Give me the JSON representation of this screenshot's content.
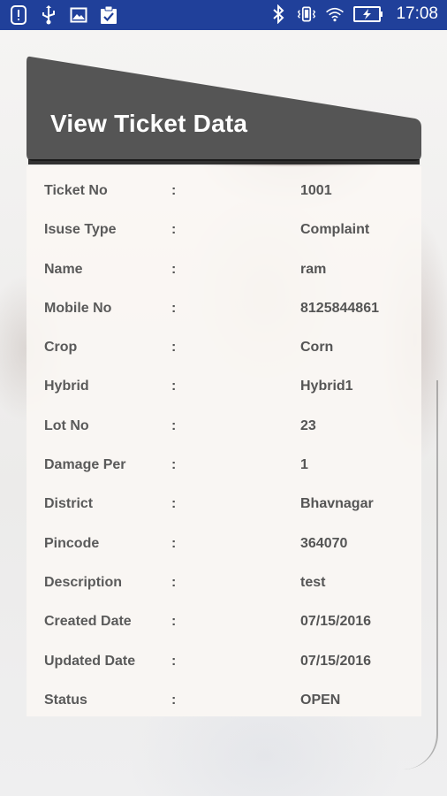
{
  "status_bar": {
    "left_icons": [
      "alert-icon",
      "usb-icon",
      "image-icon",
      "clipboard-icon"
    ],
    "right_icons": [
      "bluetooth-icon",
      "vibrate-icon",
      "wifi-icon",
      "battery-charging-icon"
    ],
    "time": "17:08",
    "bar_color": "#20409a"
  },
  "card": {
    "title": "View Ticket Data",
    "header_color": "#555555"
  },
  "ticket": {
    "separator": ":",
    "rows": [
      {
        "label": "Ticket No",
        "value": "1001"
      },
      {
        "label": "Isuse Type",
        "value": "Complaint"
      },
      {
        "label": "Name",
        "value": "ram"
      },
      {
        "label": "Mobile No",
        "value": "8125844861"
      },
      {
        "label": "Crop",
        "value": "Corn"
      },
      {
        "label": "Hybrid",
        "value": "Hybrid1"
      },
      {
        "label": "Lot No",
        "value": "23"
      },
      {
        "label": "Damage Per",
        "value": "1"
      },
      {
        "label": "District",
        "value": "Bhavnagar"
      },
      {
        "label": "Pincode",
        "value": "364070"
      },
      {
        "label": "Description",
        "value": "test"
      },
      {
        "label": "Created Date",
        "value": "07/15/2016"
      },
      {
        "label": "Updated Date",
        "value": "07/15/2016"
      },
      {
        "label": "Status",
        "value": "OPEN"
      }
    ]
  }
}
